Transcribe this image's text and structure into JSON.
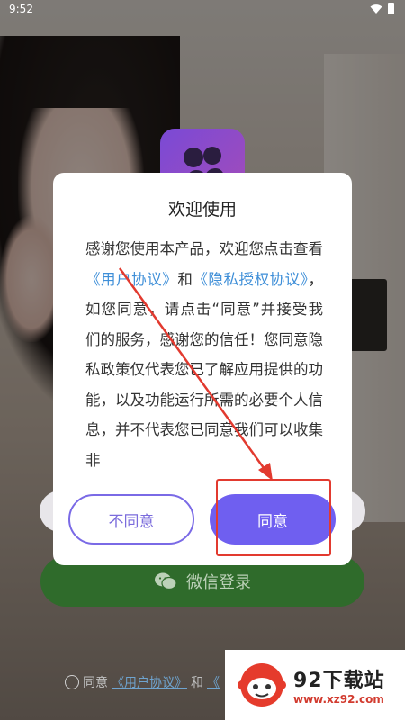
{
  "status_bar": {
    "time": "9:52"
  },
  "dialog": {
    "title": "欢迎使用",
    "body_parts": {
      "p1": "感谢您使用本产品，欢迎您点击查看",
      "link_user": "《用户协议》",
      "p2": "和",
      "link_privacy": "《隐私授权协议》",
      "p3": "，如您同意，请点击“同意”并接受我们的服务，感谢您的信任！您同意隐私政策仅代表您已了解应用提供的功能，以及功能运行所需的必要个人信息，并不代表您已同意我们可以收集非"
    },
    "disagree_label": "不同意",
    "agree_label": "同意"
  },
  "login": {
    "wechat_label": "微信登录",
    "agreement_prefix": "同意",
    "agreement_link": "《用户协议》",
    "agreement_and": "和",
    "agreement_link_cut": "《"
  },
  "watermark": {
    "name": "92下载站",
    "url": "www.xz92.com"
  },
  "colors": {
    "accent": "#6f5ff0",
    "link": "#3f8fd8",
    "annotation": "#e23a2f",
    "wechat_green": "#2f6b2b"
  }
}
